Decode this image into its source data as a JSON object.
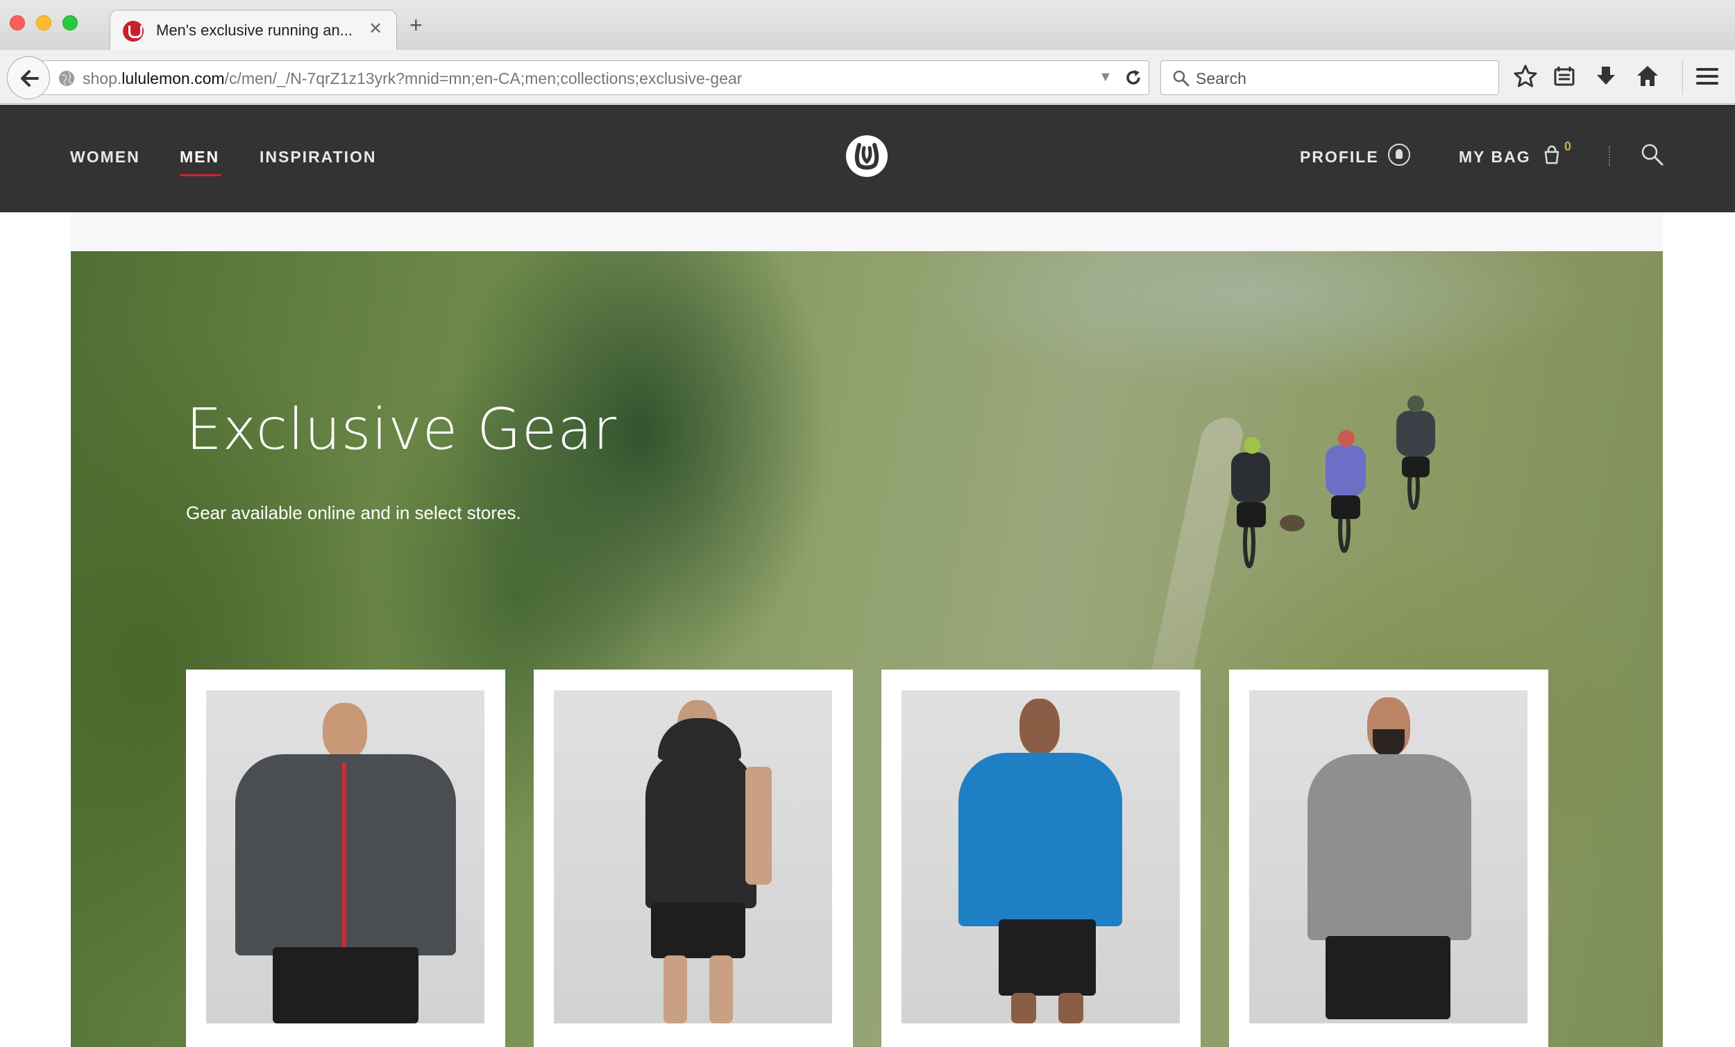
{
  "browser": {
    "tab_title": "Men's exclusive running an...",
    "url_host_prefix": "shop.",
    "url_host": "lululemon.com",
    "url_path": "/c/men/_/N-7qrZ1z13yrk?mnid=mn;en-CA;men;collections;exclusive-gear",
    "search_placeholder": "Search"
  },
  "site": {
    "nav": [
      {
        "label": "WOMEN"
      },
      {
        "label": "MEN"
      },
      {
        "label": "INSPIRATION"
      }
    ],
    "profile_label": "PROFILE",
    "bag_label": "MY BAG",
    "bag_count": "0"
  },
  "hero": {
    "title": "Exclusive Gear",
    "subtitle": "Gear available online and in select stores."
  },
  "colors": {
    "header_bg": "#333333",
    "accent_red": "#d22030",
    "bag_count": "#d4a84a"
  },
  "products": [
    {
      "top_color": "#4a4d52",
      "detail": "red-zip"
    },
    {
      "top_color": "#2a2a2c",
      "detail": "hoodie"
    },
    {
      "top_color": "#1f7fc4",
      "detail": "long-sleeve"
    },
    {
      "top_color": "#8e8f91",
      "detail": "long-sleeve"
    }
  ]
}
